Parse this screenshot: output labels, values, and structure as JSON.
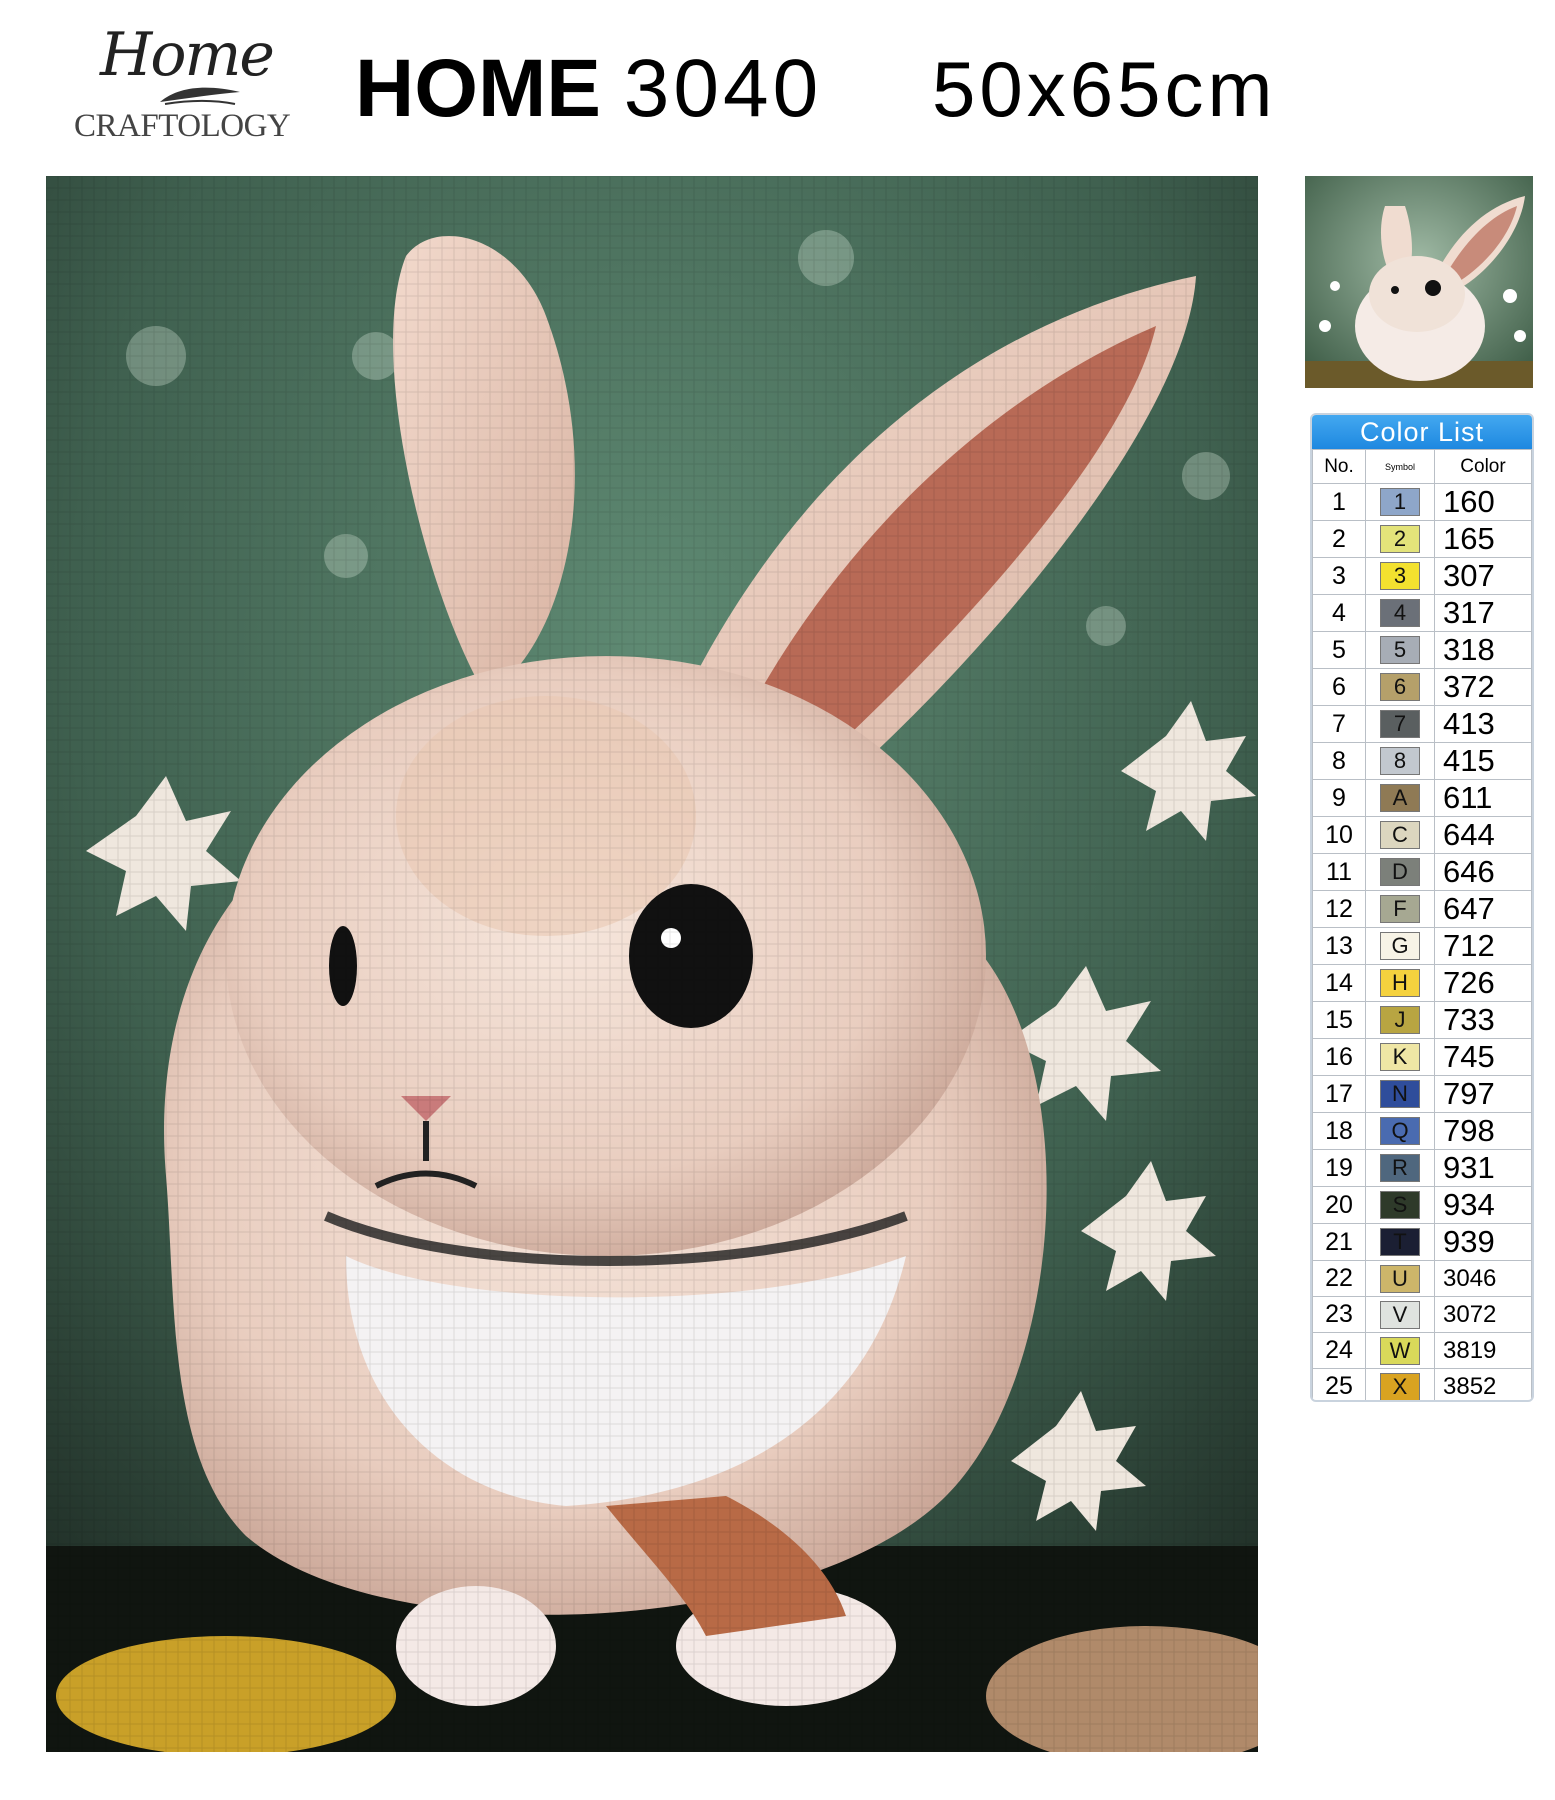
{
  "brand": {
    "script": "Home",
    "name": "CRAFTOLOGY"
  },
  "header": {
    "product_prefix": "HOME",
    "product_code": "3040",
    "size": "50x65cm"
  },
  "color_list": {
    "title": "Color List",
    "columns": {
      "no": "No.",
      "symbol": "Symbol",
      "color": "Color"
    },
    "rows": [
      {
        "no": "1",
        "symbol": "1",
        "color": "160",
        "chip": "#8ea6c9"
      },
      {
        "no": "2",
        "symbol": "2",
        "color": "165",
        "chip": "#e3e37a"
      },
      {
        "no": "3",
        "symbol": "3",
        "color": "307",
        "chip": "#f3e12f"
      },
      {
        "no": "4",
        "symbol": "4",
        "color": "317",
        "chip": "#6b7078"
      },
      {
        "no": "5",
        "symbol": "5",
        "color": "318",
        "chip": "#a7adb6"
      },
      {
        "no": "6",
        "symbol": "6",
        "color": "372",
        "chip": "#b5a06a"
      },
      {
        "no": "7",
        "symbol": "7",
        "color": "413",
        "chip": "#5a5f60"
      },
      {
        "no": "8",
        "symbol": "8",
        "color": "415",
        "chip": "#c2c8cf"
      },
      {
        "no": "9",
        "symbol": "A",
        "color": "611",
        "chip": "#8f7a55"
      },
      {
        "no": "10",
        "symbol": "C",
        "color": "644",
        "chip": "#dcd6bf"
      },
      {
        "no": "11",
        "symbol": "D",
        "color": "646",
        "chip": "#7c807a"
      },
      {
        "no": "12",
        "symbol": "F",
        "color": "647",
        "chip": "#a6a892"
      },
      {
        "no": "13",
        "symbol": "G",
        "color": "712",
        "chip": "#f7f3e6"
      },
      {
        "no": "14",
        "symbol": "H",
        "color": "726",
        "chip": "#f5d23e"
      },
      {
        "no": "15",
        "symbol": "J",
        "color": "733",
        "chip": "#b8a542"
      },
      {
        "no": "16",
        "symbol": "K",
        "color": "745",
        "chip": "#efe6a5"
      },
      {
        "no": "17",
        "symbol": "N",
        "color": "797",
        "chip": "#2f4d9b"
      },
      {
        "no": "18",
        "symbol": "Q",
        "color": "798",
        "chip": "#4a6bb0"
      },
      {
        "no": "19",
        "symbol": "R",
        "color": "931",
        "chip": "#4f677e"
      },
      {
        "no": "20",
        "symbol": "S",
        "color": "934",
        "chip": "#2e3a2a"
      },
      {
        "no": "21",
        "symbol": "T",
        "color": "939",
        "chip": "#1b1f33"
      },
      {
        "no": "22",
        "symbol": "U",
        "color": "3046",
        "chip": "#cdb66a"
      },
      {
        "no": "23",
        "symbol": "V",
        "color": "3072",
        "chip": "#dfe3df"
      },
      {
        "no": "24",
        "symbol": "W",
        "color": "3819",
        "chip": "#d9d95a"
      },
      {
        "no": "25",
        "symbol": "X",
        "color": "3852",
        "chip": "#d9a321"
      }
    ]
  }
}
